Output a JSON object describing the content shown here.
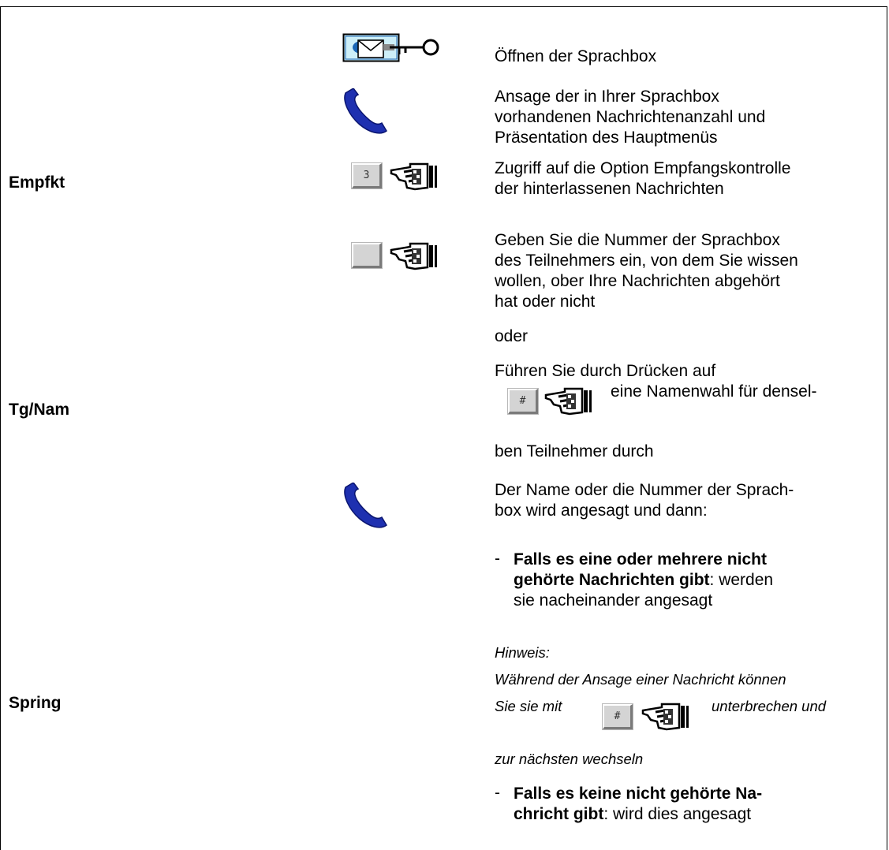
{
  "labels": {
    "empfkt": "Empfkt",
    "tgnam": "Tg/Nam",
    "spring": "Spring"
  },
  "steps": {
    "open": "Öffnen der Sprachbox",
    "announce": [
      "Ansage der in Ihrer Sprachbox",
      "vorhandenen Nachrichtenanzahl und",
      "Präsentation des Hauptmenüs"
    ],
    "access": [
      "Zugriff auf die Option Empfangskontrolle",
      "der hinterlassenen Nachrichten"
    ],
    "enter": [
      "Geben Sie die Nummer der Sprachbox",
      "des Teilnehmers ein, von dem Sie wissen",
      "wollen, ober Ihre Nachrichten abgehört",
      "hat oder nicht"
    ],
    "or": "oder",
    "press": "Führen Sie durch Drücken auf",
    "namewahl": "eine Namenwahl für densel-",
    "same": "ben Teilnehmer durch",
    "name_announce": [
      "Der Name oder die Nummer der Sprach-",
      "box wird angesagt und dann:"
    ],
    "case1_bold": [
      "Falls es eine oder mehrere nicht",
      "gehörte Nachrichten gibt"
    ],
    "case1_rest": ": werden",
    "case1_tail": "sie nacheinander angesagt",
    "note_title": "Hinweis:",
    "note_line1": "Während der Ansage einer Nachricht können",
    "note_line2a": "Sie sie mit",
    "note_line2b": "unterbrechen und",
    "note_line3": "zur nächsten wechseln",
    "case2_bold": [
      "Falls es keine nicht gehörte Na-",
      "chricht gibt"
    ],
    "case2_rest": ": wird dies angesagt",
    "dash": "-"
  },
  "keys": {
    "three": "3",
    "blank": "",
    "hash": "#"
  },
  "icons": [
    "mailbox-key-icon",
    "handset-icon",
    "keypad-hand-icon"
  ]
}
